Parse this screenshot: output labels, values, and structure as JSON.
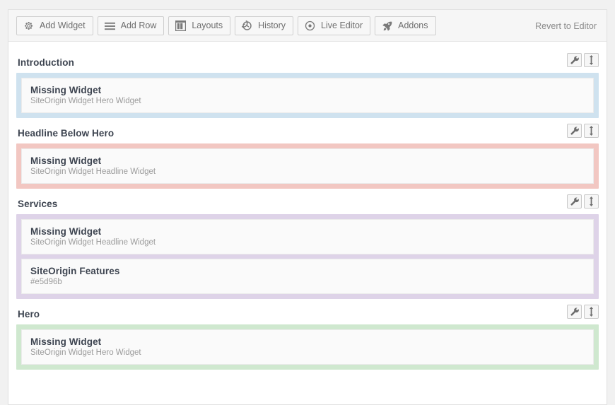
{
  "toolbar": {
    "buttons": [
      {
        "label": "Add Widget",
        "icon": "gear-icon"
      },
      {
        "label": "Add Row",
        "icon": "rows-icon"
      },
      {
        "label": "Layouts",
        "icon": "layouts-icon"
      },
      {
        "label": "History",
        "icon": "history-icon"
      },
      {
        "label": "Live Editor",
        "icon": "eye-target-icon"
      },
      {
        "label": "Addons",
        "icon": "rocket-icon"
      }
    ],
    "revert_label": "Revert to Editor"
  },
  "row_actions": {
    "settings_label": "Row Settings",
    "move_label": "Move Row",
    "settings_icon": "wrench-icon",
    "move_icon": "move-vertical-icon"
  },
  "colors": {
    "row_introduction": "#cfe2ef",
    "row_headline": "#f2c7c2",
    "row_services": "#ded3e8",
    "row_hero": "#cfe8cf",
    "widget_bg": "#fafafa",
    "panel_bg": "#ffffff",
    "page_bg": "#f1f1f1",
    "toolbar_bg": "#f6f6f6",
    "title_color": "#3d4450",
    "sub_color": "#9b9b9b"
  },
  "rows": [
    {
      "title": "Introduction",
      "accent": "#cfe2ef",
      "widgets": [
        {
          "title": "Missing Widget",
          "subtitle": "SiteOrigin Widget Hero Widget"
        }
      ]
    },
    {
      "title": "Headline Below Hero",
      "accent": "#f2c7c2",
      "widgets": [
        {
          "title": "Missing Widget",
          "subtitle": "SiteOrigin Widget Headline Widget"
        }
      ]
    },
    {
      "title": "Services",
      "accent": "#ded3e8",
      "widgets": [
        {
          "title": "Missing Widget",
          "subtitle": "SiteOrigin Widget Headline Widget"
        },
        {
          "title": "SiteOrigin Features",
          "subtitle": "#e5d96b"
        }
      ]
    },
    {
      "title": "Hero",
      "accent": "#cfe8cf",
      "widgets": [
        {
          "title": "Missing Widget",
          "subtitle": "SiteOrigin Widget Hero Widget"
        }
      ]
    }
  ]
}
